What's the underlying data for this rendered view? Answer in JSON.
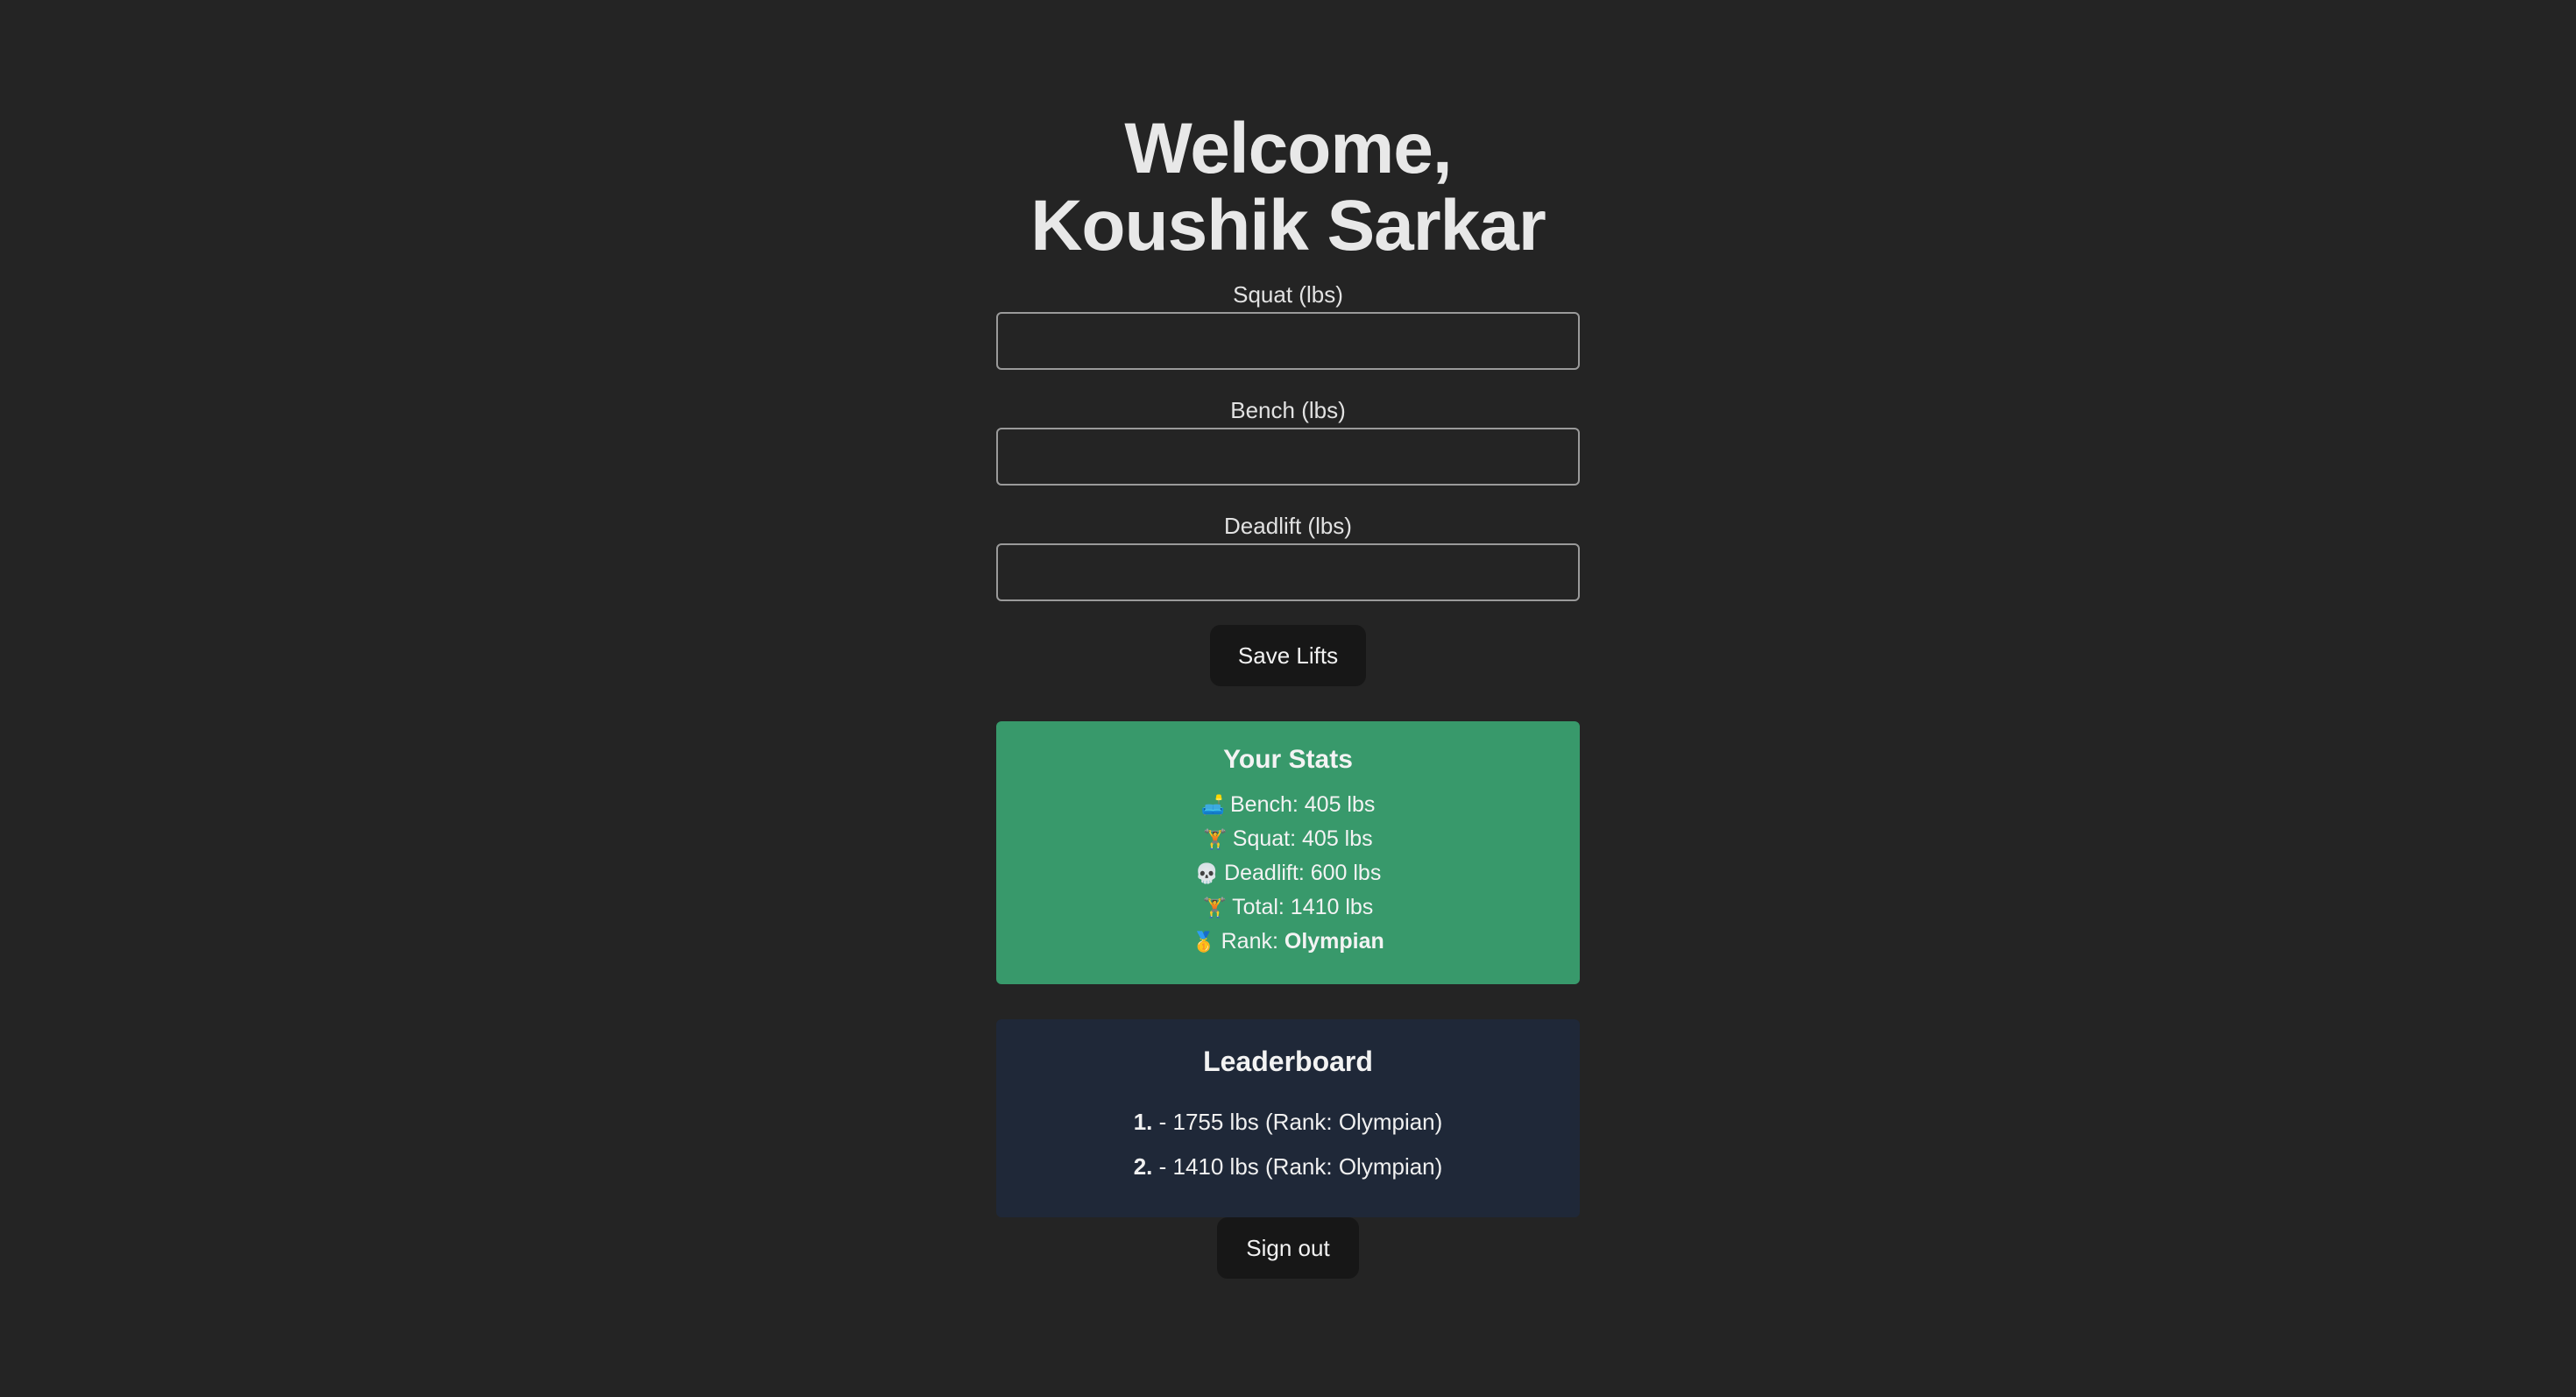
{
  "header": {
    "welcome_line1": "Welcome,",
    "welcome_line2": "Koushik Sarkar"
  },
  "form": {
    "squat_label": "Squat (lbs)",
    "squat_value": "",
    "bench_label": "Bench (lbs)",
    "bench_value": "",
    "deadlift_label": "Deadlift (lbs)",
    "deadlift_value": "",
    "save_label": "Save Lifts"
  },
  "stats": {
    "title": "Your Stats",
    "bench_icon": "🛋️",
    "bench_text": "Bench: 405 lbs",
    "squat_icon": "🏋️",
    "squat_text": "Squat: 405 lbs",
    "deadlift_icon": "💀",
    "deadlift_text": "Deadlift: 600 lbs",
    "total_icon": "🏋",
    "total_text": "Total: 1410 lbs",
    "rank_icon": "🥇",
    "rank_prefix": "Rank: ",
    "rank_value": "Olympian",
    "background_color": "#38996b"
  },
  "leaderboard": {
    "title": "Leaderboard",
    "rows": [
      {
        "position": "1.",
        "text": " - 1755 lbs (Rank: Olympian)"
      },
      {
        "position": "2.",
        "text": " - 1410 lbs (Rank: Olympian)"
      }
    ],
    "background_color": "#1f2838"
  },
  "footer": {
    "signout_label": "Sign out"
  }
}
